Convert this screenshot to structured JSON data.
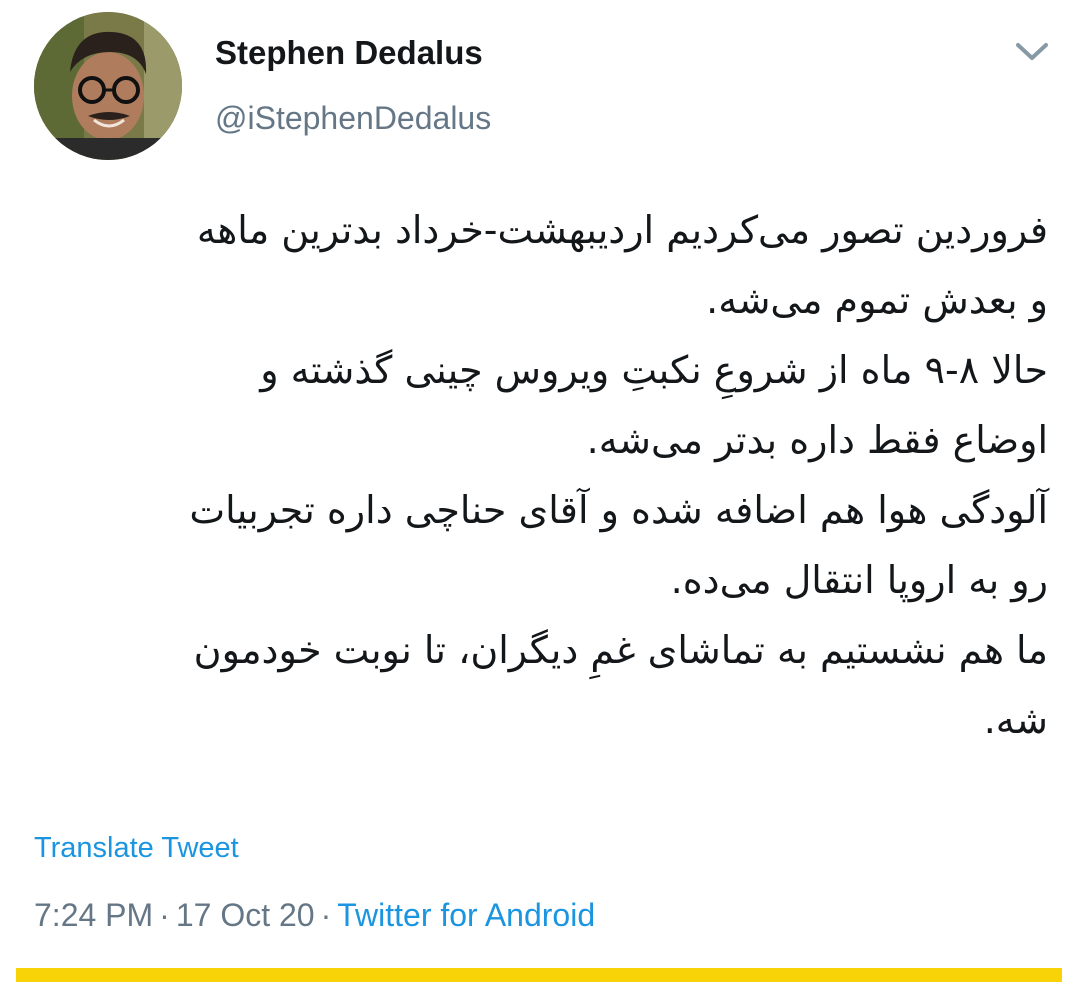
{
  "user": {
    "display_name": "Stephen Dedalus",
    "handle": "@iStephenDedalus",
    "avatar_icon": "user-avatar-photo"
  },
  "menu": {
    "icon": "chevron-down-icon"
  },
  "tweet": {
    "lines": [
      "فروردین تصور می‌کردیم اردیبهشت-خرداد بدترین ماهه",
      "و بعدش تموم می‌شه.",
      "حالا ۸-۹ ماه از شروعِ نکبتِ ویروس چینی گذشته و",
      "اوضاع فقط داره بدتر می‌شه.",
      "آلودگی هوا هم اضافه شده و آقای حناچی داره تجربیات",
      "رو به اروپا انتقال می‌ده.",
      "ما هم نشستیم به تماشای غمِ دیگران، تا نوبت خودمون",
      "شه."
    ],
    "translate_label": "Translate Tweet",
    "time": "7:24 PM",
    "separator": "·",
    "date": "17 Oct 20",
    "source": "Twitter for Android"
  },
  "colors": {
    "accent": "#1b95e0",
    "muted": "#657786",
    "text": "#14171a",
    "bottom_bar": "#f7d308"
  }
}
